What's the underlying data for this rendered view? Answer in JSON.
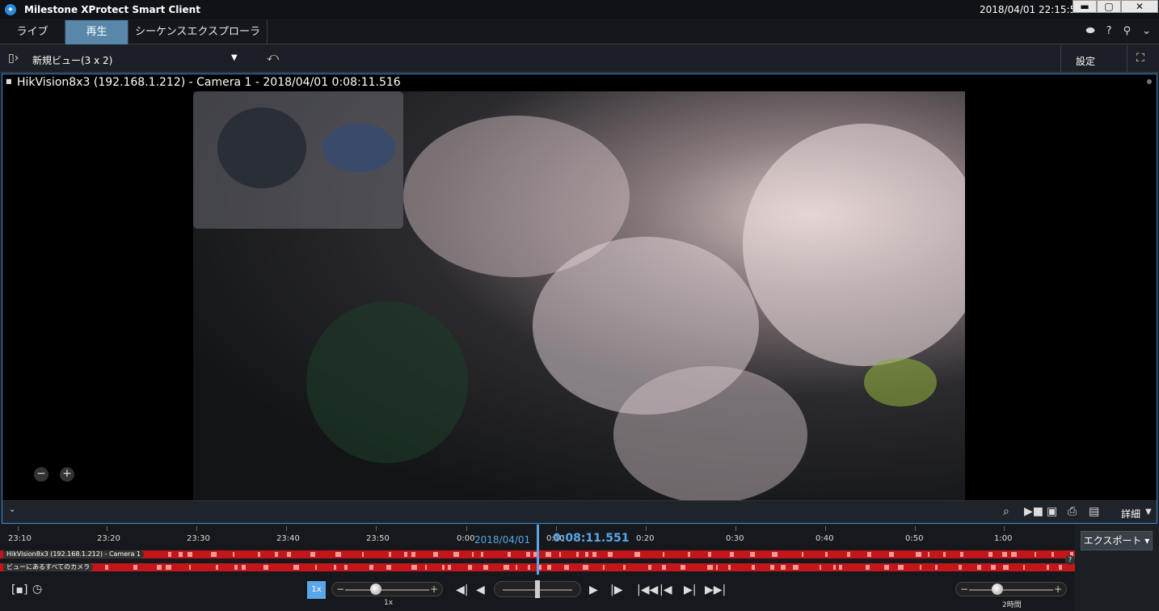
{
  "window": {
    "title": "Milestone XProtect Smart Client",
    "clock": "2018/04/01 22:15:51",
    "minimize": "▬",
    "maximize": "▢",
    "close": "✕"
  },
  "tabs": [
    {
      "label": "ライブ",
      "active": false
    },
    {
      "label": "再生",
      "active": true
    },
    {
      "label": "シーケンスエクスプローラ",
      "active": false
    }
  ],
  "toolbar": {
    "view_name": "新規ビュー(3 x 2)",
    "settings_label": "設定"
  },
  "camera": {
    "title": "HikVision8x3 (192.168.1.212) - Camera 1 - 2018/04/01 0:08:11.516"
  },
  "view_bar": {
    "detail_label": "詳細"
  },
  "timeline": {
    "ticks": [
      "23:10",
      "23:20",
      "23:30",
      "23:40",
      "23:50",
      "0:00",
      "0:10",
      "0:20",
      "0:30",
      "0:40",
      "0:50",
      "1:00"
    ],
    "date": "2018/04/01",
    "time": "0:08:11.551",
    "tracks": [
      {
        "label": "HikVision8x3 (192.168.1.212) - Camera 1"
      },
      {
        "label": "ビューにあるすべてのカメラ"
      }
    ]
  },
  "controls": {
    "speed_button": "1x",
    "speed_label": "1x",
    "span_label": "2時間",
    "export_label": "エクスポート ▾",
    "help": "?"
  },
  "colors": {
    "accent": "#5aa6e6",
    "recording": "#c3161a",
    "active_tab": "#5887a9"
  }
}
